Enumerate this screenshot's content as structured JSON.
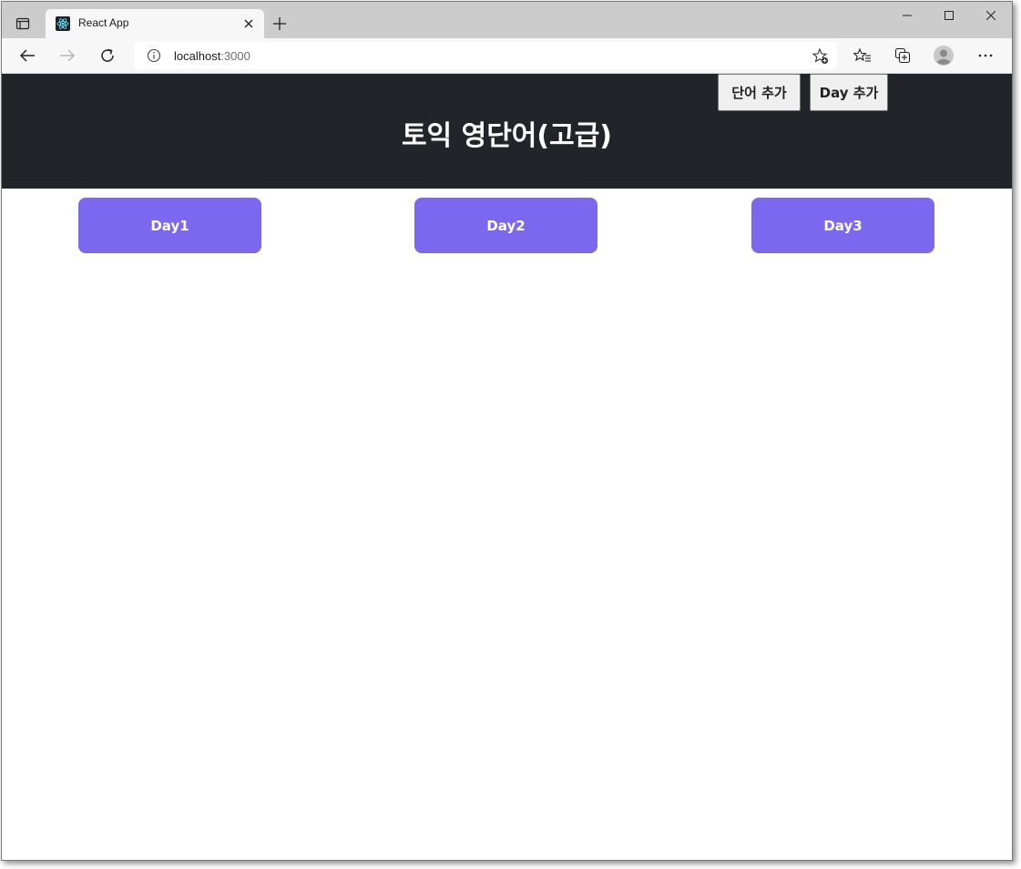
{
  "browser": {
    "tab_title": "React App",
    "url_host": "localhost",
    "url_port": ":3000"
  },
  "header": {
    "title": "토익 영단어(고급)",
    "add_word_label": "단어 추가",
    "add_day_label": "Day 추가"
  },
  "days": [
    {
      "label": "Day1"
    },
    {
      "label": "Day2"
    },
    {
      "label": "Day3"
    }
  ],
  "colors": {
    "header_bg": "#212529",
    "day_button_bg": "#7b68ee"
  }
}
